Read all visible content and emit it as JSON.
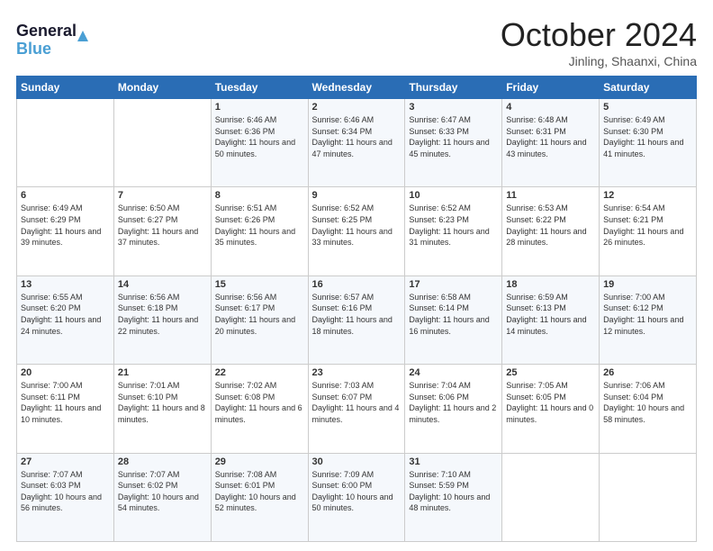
{
  "logo": {
    "line1": "General",
    "line2": "Blue"
  },
  "header": {
    "month": "October 2024",
    "location": "Jinling, Shaanxi, China"
  },
  "weekdays": [
    "Sunday",
    "Monday",
    "Tuesday",
    "Wednesday",
    "Thursday",
    "Friday",
    "Saturday"
  ],
  "weeks": [
    [
      {
        "day": "",
        "sunrise": "",
        "sunset": "",
        "daylight": ""
      },
      {
        "day": "",
        "sunrise": "",
        "sunset": "",
        "daylight": ""
      },
      {
        "day": "1",
        "sunrise": "Sunrise: 6:46 AM",
        "sunset": "Sunset: 6:36 PM",
        "daylight": "Daylight: 11 hours and 50 minutes."
      },
      {
        "day": "2",
        "sunrise": "Sunrise: 6:46 AM",
        "sunset": "Sunset: 6:34 PM",
        "daylight": "Daylight: 11 hours and 47 minutes."
      },
      {
        "day": "3",
        "sunrise": "Sunrise: 6:47 AM",
        "sunset": "Sunset: 6:33 PM",
        "daylight": "Daylight: 11 hours and 45 minutes."
      },
      {
        "day": "4",
        "sunrise": "Sunrise: 6:48 AM",
        "sunset": "Sunset: 6:31 PM",
        "daylight": "Daylight: 11 hours and 43 minutes."
      },
      {
        "day": "5",
        "sunrise": "Sunrise: 6:49 AM",
        "sunset": "Sunset: 6:30 PM",
        "daylight": "Daylight: 11 hours and 41 minutes."
      }
    ],
    [
      {
        "day": "6",
        "sunrise": "Sunrise: 6:49 AM",
        "sunset": "Sunset: 6:29 PM",
        "daylight": "Daylight: 11 hours and 39 minutes."
      },
      {
        "day": "7",
        "sunrise": "Sunrise: 6:50 AM",
        "sunset": "Sunset: 6:27 PM",
        "daylight": "Daylight: 11 hours and 37 minutes."
      },
      {
        "day": "8",
        "sunrise": "Sunrise: 6:51 AM",
        "sunset": "Sunset: 6:26 PM",
        "daylight": "Daylight: 11 hours and 35 minutes."
      },
      {
        "day": "9",
        "sunrise": "Sunrise: 6:52 AM",
        "sunset": "Sunset: 6:25 PM",
        "daylight": "Daylight: 11 hours and 33 minutes."
      },
      {
        "day": "10",
        "sunrise": "Sunrise: 6:52 AM",
        "sunset": "Sunset: 6:23 PM",
        "daylight": "Daylight: 11 hours and 31 minutes."
      },
      {
        "day": "11",
        "sunrise": "Sunrise: 6:53 AM",
        "sunset": "Sunset: 6:22 PM",
        "daylight": "Daylight: 11 hours and 28 minutes."
      },
      {
        "day": "12",
        "sunrise": "Sunrise: 6:54 AM",
        "sunset": "Sunset: 6:21 PM",
        "daylight": "Daylight: 11 hours and 26 minutes."
      }
    ],
    [
      {
        "day": "13",
        "sunrise": "Sunrise: 6:55 AM",
        "sunset": "Sunset: 6:20 PM",
        "daylight": "Daylight: 11 hours and 24 minutes."
      },
      {
        "day": "14",
        "sunrise": "Sunrise: 6:56 AM",
        "sunset": "Sunset: 6:18 PM",
        "daylight": "Daylight: 11 hours and 22 minutes."
      },
      {
        "day": "15",
        "sunrise": "Sunrise: 6:56 AM",
        "sunset": "Sunset: 6:17 PM",
        "daylight": "Daylight: 11 hours and 20 minutes."
      },
      {
        "day": "16",
        "sunrise": "Sunrise: 6:57 AM",
        "sunset": "Sunset: 6:16 PM",
        "daylight": "Daylight: 11 hours and 18 minutes."
      },
      {
        "day": "17",
        "sunrise": "Sunrise: 6:58 AM",
        "sunset": "Sunset: 6:14 PM",
        "daylight": "Daylight: 11 hours and 16 minutes."
      },
      {
        "day": "18",
        "sunrise": "Sunrise: 6:59 AM",
        "sunset": "Sunset: 6:13 PM",
        "daylight": "Daylight: 11 hours and 14 minutes."
      },
      {
        "day": "19",
        "sunrise": "Sunrise: 7:00 AM",
        "sunset": "Sunset: 6:12 PM",
        "daylight": "Daylight: 11 hours and 12 minutes."
      }
    ],
    [
      {
        "day": "20",
        "sunrise": "Sunrise: 7:00 AM",
        "sunset": "Sunset: 6:11 PM",
        "daylight": "Daylight: 11 hours and 10 minutes."
      },
      {
        "day": "21",
        "sunrise": "Sunrise: 7:01 AM",
        "sunset": "Sunset: 6:10 PM",
        "daylight": "Daylight: 11 hours and 8 minutes."
      },
      {
        "day": "22",
        "sunrise": "Sunrise: 7:02 AM",
        "sunset": "Sunset: 6:08 PM",
        "daylight": "Daylight: 11 hours and 6 minutes."
      },
      {
        "day": "23",
        "sunrise": "Sunrise: 7:03 AM",
        "sunset": "Sunset: 6:07 PM",
        "daylight": "Daylight: 11 hours and 4 minutes."
      },
      {
        "day": "24",
        "sunrise": "Sunrise: 7:04 AM",
        "sunset": "Sunset: 6:06 PM",
        "daylight": "Daylight: 11 hours and 2 minutes."
      },
      {
        "day": "25",
        "sunrise": "Sunrise: 7:05 AM",
        "sunset": "Sunset: 6:05 PM",
        "daylight": "Daylight: 11 hours and 0 minutes."
      },
      {
        "day": "26",
        "sunrise": "Sunrise: 7:06 AM",
        "sunset": "Sunset: 6:04 PM",
        "daylight": "Daylight: 10 hours and 58 minutes."
      }
    ],
    [
      {
        "day": "27",
        "sunrise": "Sunrise: 7:07 AM",
        "sunset": "Sunset: 6:03 PM",
        "daylight": "Daylight: 10 hours and 56 minutes."
      },
      {
        "day": "28",
        "sunrise": "Sunrise: 7:07 AM",
        "sunset": "Sunset: 6:02 PM",
        "daylight": "Daylight: 10 hours and 54 minutes."
      },
      {
        "day": "29",
        "sunrise": "Sunrise: 7:08 AM",
        "sunset": "Sunset: 6:01 PM",
        "daylight": "Daylight: 10 hours and 52 minutes."
      },
      {
        "day": "30",
        "sunrise": "Sunrise: 7:09 AM",
        "sunset": "Sunset: 6:00 PM",
        "daylight": "Daylight: 10 hours and 50 minutes."
      },
      {
        "day": "31",
        "sunrise": "Sunrise: 7:10 AM",
        "sunset": "Sunset: 5:59 PM",
        "daylight": "Daylight: 10 hours and 48 minutes."
      },
      {
        "day": "",
        "sunrise": "",
        "sunset": "",
        "daylight": ""
      },
      {
        "day": "",
        "sunrise": "",
        "sunset": "",
        "daylight": ""
      }
    ]
  ]
}
